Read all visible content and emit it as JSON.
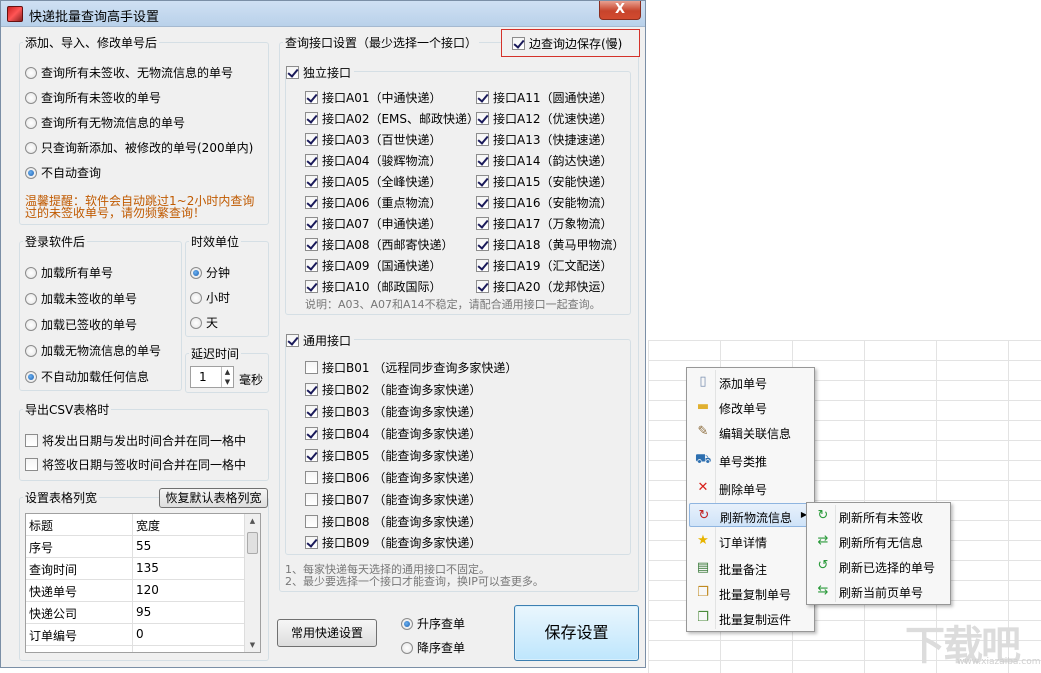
{
  "window": {
    "title": "快递批量查询高手设置",
    "close_glyph": "X"
  },
  "after_add": {
    "title": "添加、导入、修改单号后",
    "options": [
      {
        "label": "查询所有未签收、无物流信息的单号",
        "selected": false
      },
      {
        "label": "查询所有未签收的单号",
        "selected": false
      },
      {
        "label": "查询所有无物流信息的单号",
        "selected": false
      },
      {
        "label": "只查询新添加、被修改的单号(200单内)",
        "selected": false
      },
      {
        "label": "不自动查询",
        "selected": true
      }
    ],
    "warning_line1": "温馨提醒：软件会自动跳过1~2小时内查询",
    "warning_line2": "过的未签收单号，请勿频繁查询！"
  },
  "after_login": {
    "title": "登录软件后",
    "options": [
      {
        "label": "加载所有单号",
        "selected": false
      },
      {
        "label": "加载未签收的单号",
        "selected": false
      },
      {
        "label": "加载已签收的单号",
        "selected": false
      },
      {
        "label": "加载无物流信息的单号",
        "selected": false
      },
      {
        "label": "不自动加载任何信息",
        "selected": true
      }
    ]
  },
  "time_unit": {
    "title": "时效单位",
    "options": [
      {
        "label": "分钟",
        "selected": true
      },
      {
        "label": "小时",
        "selected": false
      },
      {
        "label": "天",
        "selected": false
      }
    ]
  },
  "delay": {
    "title": "延迟时间",
    "value": "1",
    "unit": "毫秒"
  },
  "csv_export": {
    "title": "导出CSV表格时",
    "options": [
      {
        "label": "将发出日期与发出时间合并在同一格中",
        "checked": false
      },
      {
        "label": "将签收日期与签收时间合并在同一格中",
        "checked": false
      }
    ]
  },
  "columns": {
    "title": "设置表格列宽",
    "reset_label": "恢复默认表格列宽",
    "headers": [
      "标题",
      "宽度"
    ],
    "rows": [
      [
        "序号",
        "55"
      ],
      [
        "查询时间",
        "135"
      ],
      [
        "快递单号",
        "120"
      ],
      [
        "快递公司",
        "95"
      ],
      [
        "订单编号",
        "0"
      ]
    ]
  },
  "interface": {
    "title": "查询接口设置（最少选择一个接口）",
    "save_while_query": {
      "label": "边查询边保存(慢)",
      "checked": true
    },
    "independent": {
      "label": "独立接口",
      "checked": true,
      "items_left": [
        {
          "label": "接口A01（中通快递）",
          "checked": true
        },
        {
          "label": "接口A02（EMS、邮政快递）",
          "checked": true
        },
        {
          "label": "接口A03（百世快递）",
          "checked": true
        },
        {
          "label": "接口A04（骏辉物流）",
          "checked": true
        },
        {
          "label": "接口A05（全峰快递）",
          "checked": true
        },
        {
          "label": "接口A06（重点物流）",
          "checked": true
        },
        {
          "label": "接口A07（申通快递）",
          "checked": true
        },
        {
          "label": "接口A08（西邮寄快递）",
          "checked": true
        },
        {
          "label": "接口A09（国通快递）",
          "checked": true
        },
        {
          "label": "接口A10（邮政国际）",
          "checked": true
        }
      ],
      "items_right": [
        {
          "label": "接口A11（圆通快递）",
          "checked": true
        },
        {
          "label": "接口A12（优速快递）",
          "checked": true
        },
        {
          "label": "接口A13（快捷速递）",
          "checked": true
        },
        {
          "label": "接口A14（韵达快递）",
          "checked": true
        },
        {
          "label": "接口A15（安能快递）",
          "checked": true
        },
        {
          "label": "接口A16（安能物流）",
          "checked": true
        },
        {
          "label": "接口A17（万象物流）",
          "checked": true
        },
        {
          "label": "接口A18（黄马甲物流）",
          "checked": true
        },
        {
          "label": "接口A19（汇文配送）",
          "checked": true
        },
        {
          "label": "接口A20（龙邦快运）",
          "checked": true
        }
      ],
      "note": "说明：A03、A07和A14不稳定，请配合通用接口一起查询。"
    },
    "general": {
      "label": "通用接口",
      "checked": true,
      "items": [
        {
          "label": "接口B01  （远程同步查询多家快递）",
          "checked": false
        },
        {
          "label": "接口B02  （能查询多家快递）",
          "checked": true
        },
        {
          "label": "接口B03  （能查询多家快递）",
          "checked": true
        },
        {
          "label": "接口B04  （能查询多家快递）",
          "checked": true
        },
        {
          "label": "接口B05  （能查询多家快递）",
          "checked": true
        },
        {
          "label": "接口B06  （能查询多家快递）",
          "checked": false
        },
        {
          "label": "接口B07  （能查询多家快递）",
          "checked": false
        },
        {
          "label": "接口B08  （能查询多家快递）",
          "checked": false
        },
        {
          "label": "接口B09  （能查询多家快递）",
          "checked": true
        }
      ]
    },
    "notes": [
      "1、每家快递每天选择的通用接口不固定。",
      "2、最少要选择一个接口才能查询，换IP可以查更多。"
    ]
  },
  "bottom": {
    "common_settings_label": "常用快递设置",
    "sort_options": [
      {
        "label": "升序查单",
        "selected": true
      },
      {
        "label": "降序查单",
        "selected": false
      }
    ],
    "save_label": "保存设置"
  },
  "context_menu": {
    "items": [
      {
        "label": "添加单号",
        "icon": "page-icon"
      },
      {
        "label": "修改单号",
        "icon": "folder-icon"
      },
      {
        "label": "编辑关联信息",
        "icon": "edit-icon"
      },
      {
        "label": "单号类推",
        "icon": "truck-icon"
      },
      {
        "label": "删除单号",
        "icon": "delete-icon"
      },
      {
        "label": "刷新物流信息",
        "icon": "refresh-icon",
        "highlighted": true,
        "submenu": true
      },
      {
        "label": "订单详情",
        "icon": "star-icon"
      },
      {
        "label": "批量备注",
        "icon": "note-icon"
      },
      {
        "label": "批量复制单号",
        "icon": "copy-icon"
      },
      {
        "label": "批量复制运件",
        "icon": "copy-icon"
      }
    ],
    "submenu": [
      {
        "label": "刷新所有未签收",
        "icon": "refresh-icon"
      },
      {
        "label": "刷新所有无信息",
        "icon": "refresh-icon"
      },
      {
        "label": "刷新已选择的单号",
        "icon": "refresh-icon"
      },
      {
        "label": "刷新当前页单号",
        "icon": "refresh-icon"
      }
    ]
  },
  "watermark": {
    "text": "下载吧",
    "url": "www.xiazaiba.com"
  },
  "colors": {
    "accent_red": "#d4322a",
    "warning": "#c05a00",
    "title_bar": "#c4d9ef"
  }
}
